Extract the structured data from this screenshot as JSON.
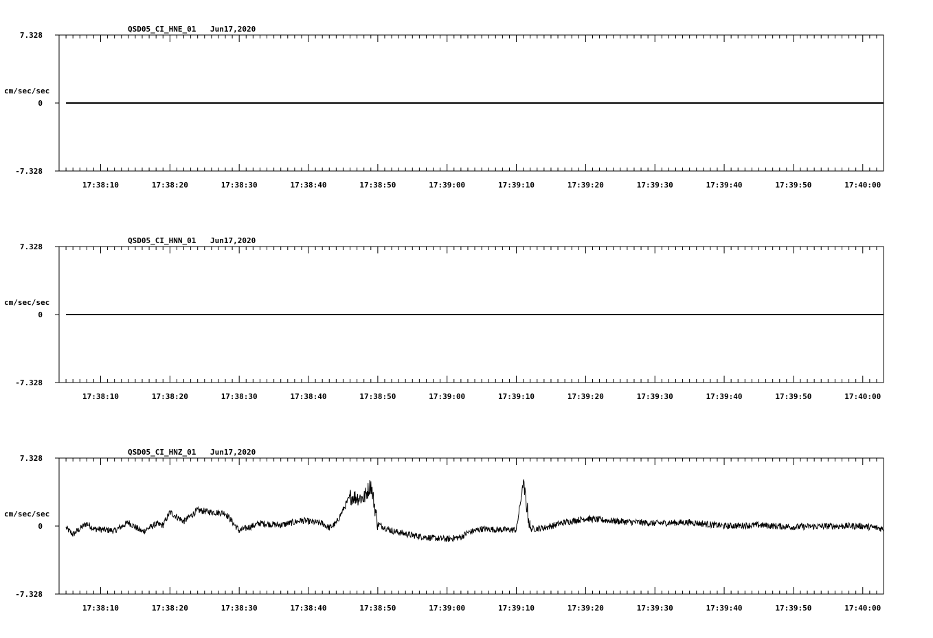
{
  "chart_data": [
    {
      "type": "line",
      "title": "QSD05_CI_HNE_01",
      "date": "Jun17,2020",
      "ylabel": "cm/sec/sec",
      "ylim": [
        -7.328,
        7.328
      ],
      "ytick_labels": [
        "7.328",
        "0",
        "-7.328"
      ],
      "xlim": [
        "17:38:04",
        "17:40:03"
      ],
      "xtick_labels": [
        "17:38:10",
        "17:38:20",
        "17:38:30",
        "17:38:40",
        "17:38:50",
        "17:39:00",
        "17:39:10",
        "17:39:20",
        "17:39:30",
        "17:39:40",
        "17:39:50",
        "17:40:00"
      ],
      "grid": false,
      "series": [
        {
          "x": [
            "17:38:05",
            "17:40:03"
          ],
          "y": [
            0,
            0
          ]
        }
      ]
    },
    {
      "type": "line",
      "title": "QSD05_CI_HNN_01",
      "date": "Jun17,2020",
      "ylabel": "cm/sec/sec",
      "ylim": [
        -7.328,
        7.328
      ],
      "ytick_labels": [
        "7.328",
        "0",
        "-7.328"
      ],
      "xlim": [
        "17:38:04",
        "17:40:03"
      ],
      "xtick_labels": [
        "17:38:10",
        "17:38:20",
        "17:38:30",
        "17:38:40",
        "17:38:50",
        "17:39:00",
        "17:39:10",
        "17:39:20",
        "17:39:30",
        "17:39:40",
        "17:39:50",
        "17:40:00"
      ],
      "grid": false,
      "series": [
        {
          "x": [
            "17:38:05",
            "17:40:03"
          ],
          "y": [
            0,
            0
          ]
        }
      ]
    },
    {
      "type": "line",
      "title": "QSD05_CI_HNZ_01",
      "date": "Jun17,2020",
      "ylabel": "cm/sec/sec",
      "ylim": [
        -7.328,
        7.328
      ],
      "ytick_labels": [
        "7.328",
        "0",
        "-7.328"
      ],
      "xlim": [
        "17:38:04",
        "17:40:03"
      ],
      "xtick_labels": [
        "17:38:10",
        "17:38:20",
        "17:38:30",
        "17:38:40",
        "17:38:50",
        "17:39:00",
        "17:39:10",
        "17:39:20",
        "17:39:30",
        "17:39:40",
        "17:39:50",
        "17:40:00"
      ],
      "grid": false,
      "series": [
        {
          "x": [
            "17:38:05",
            "17:38:06",
            "17:38:08",
            "17:38:09",
            "17:38:12",
            "17:38:14",
            "17:38:16",
            "17:38:18",
            "17:38:19",
            "17:38:20",
            "17:38:22",
            "17:38:24",
            "17:38:26",
            "17:38:28",
            "17:38:30",
            "17:38:33",
            "17:38:36",
            "17:38:39",
            "17:38:42",
            "17:38:43",
            "17:38:44",
            "17:38:46",
            "17:38:48",
            "17:38:49",
            "17:38:50",
            "17:38:52",
            "17:38:55",
            "17:38:58",
            "17:39:00",
            "17:39:02",
            "17:39:03",
            "17:39:05",
            "17:39:08",
            "17:39:10",
            "17:39:11",
            "17:39:12",
            "17:39:14",
            "17:39:17",
            "17:39:20",
            "17:39:25",
            "17:39:30",
            "17:39:35",
            "17:39:40",
            "17:39:45",
            "17:39:50",
            "17:39:55",
            "17:40:00",
            "17:40:03"
          ],
          "y": [
            -0.2,
            -0.9,
            0.3,
            -0.3,
            -0.5,
            0.4,
            -0.6,
            0.2,
            0.1,
            1.5,
            0.5,
            1.7,
            1.5,
            1.4,
            -0.5,
            0.3,
            0.1,
            0.6,
            0.3,
            -0.2,
            0.3,
            3.2,
            3.0,
            4.5,
            0.2,
            -0.5,
            -1.0,
            -1.3,
            -1.4,
            -1.2,
            -0.7,
            -0.3,
            -0.4,
            -0.4,
            4.6,
            -0.3,
            -0.2,
            0.4,
            0.8,
            0.5,
            0.3,
            0.4,
            0.0,
            0.1,
            -0.1,
            0.0,
            0.0,
            -0.3
          ]
        }
      ]
    }
  ]
}
